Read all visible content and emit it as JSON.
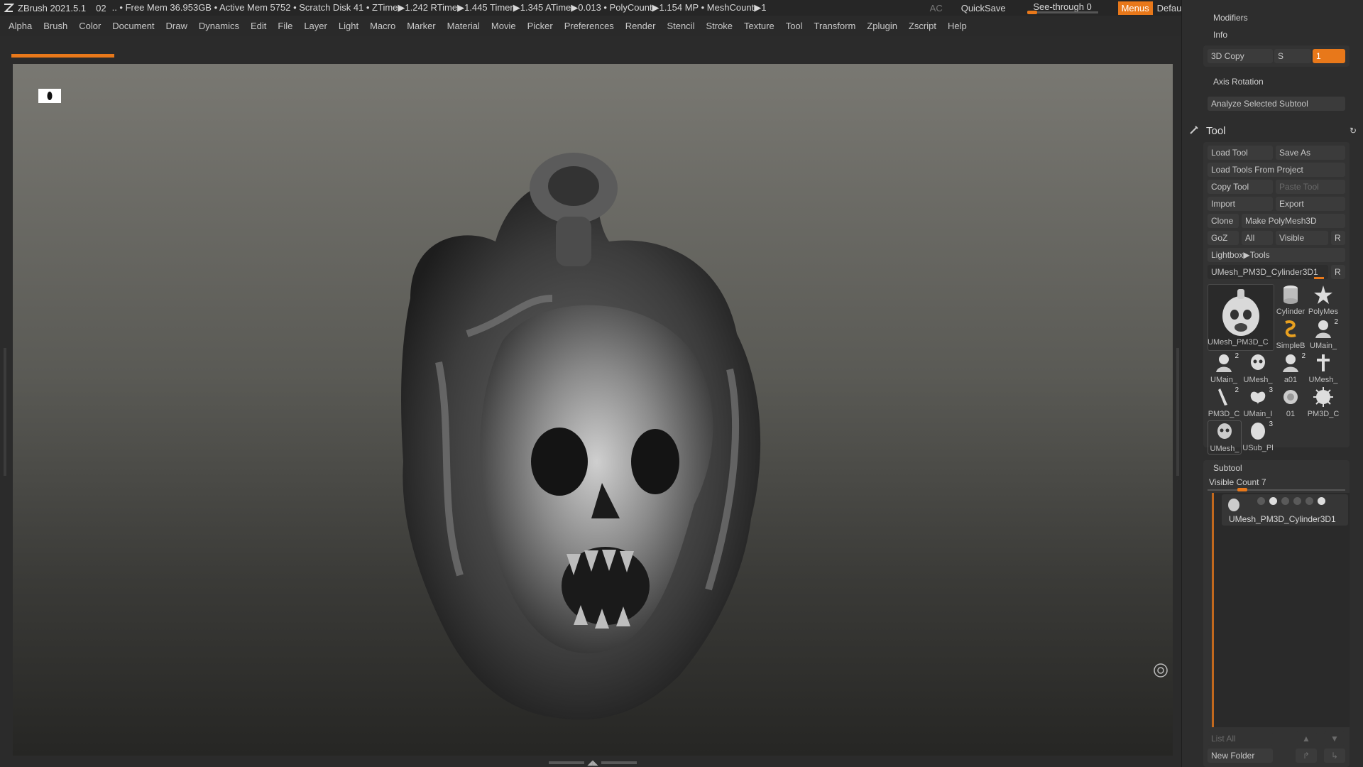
{
  "titlebar": {
    "title": "ZBrush 2021.5.1",
    "doc_index": "02",
    "stats": ".. • Free Mem 36.953GB • Active Mem 5752 • Scratch Disk 41 •  ZTime▶1.242 RTime▶1.445 Timer▶1.345 ATime▶0.013 • PolyCount▶1.154 MP  • MeshCount▶1",
    "ac": "AC",
    "quicksave": "QuickSave",
    "see_through": "See-through  0",
    "menus": "Menus",
    "default_zscript": "DefaultZScript"
  },
  "menubar": [
    "Alpha",
    "Brush",
    "Color",
    "Document",
    "Draw",
    "Dynamics",
    "Edit",
    "File",
    "Layer",
    "Light",
    "Macro",
    "Marker",
    "Material",
    "Movie",
    "Picker",
    "Preferences",
    "Render",
    "Stencil",
    "Stroke",
    "Texture",
    "Tool",
    "Transform",
    "Zplugin",
    "Zscript",
    "Help"
  ],
  "panel": {
    "modifiers": "Modifiers",
    "info": "Info",
    "copy3d": "3D Copy",
    "s_label": "S",
    "s_value": "1",
    "axis_rotation": "Axis Rotation",
    "analyze": "Analyze Selected Subtool",
    "tool_title": "Tool",
    "load_tool": "Load Tool",
    "save_as": "Save As",
    "load_from_project": "Load Tools From Project",
    "copy_tool": "Copy Tool",
    "paste_tool": "Paste Tool",
    "import": "Import",
    "export": "Export",
    "clone": "Clone",
    "make_polymesh": "Make PolyMesh3D",
    "goz": "GoZ",
    "all": "All",
    "visible": "Visible",
    "r1": "R",
    "lightbox_tools": "Lightbox▶Tools",
    "current_tool": "UMesh_PM3D_Cylinder3D1",
    "r2": "R",
    "main_thumb_label": "UMesh_PM3D_C",
    "thumbs": [
      {
        "label": "Cylinder",
        "num": ""
      },
      {
        "label": "PolyMes",
        "num": ""
      },
      {
        "label": "SimpleB",
        "num": ""
      },
      {
        "label": "UMain_",
        "num": "2"
      },
      {
        "label": "UMain_",
        "num": "2"
      },
      {
        "label": "UMesh_",
        "num": ""
      },
      {
        "label": "a01",
        "num": "2"
      },
      {
        "label": "UMesh_",
        "num": ""
      },
      {
        "label": "PM3D_C",
        "num": "2"
      },
      {
        "label": "UMain_I",
        "num": "3"
      },
      {
        "label": "01",
        "num": ""
      },
      {
        "label": "PM3D_C",
        "num": ""
      },
      {
        "label": "UMesh_",
        "num": ""
      },
      {
        "label": "USub_Pl",
        "num": "3"
      }
    ],
    "subtool": "Subtool",
    "visible_count": "Visible Count 7",
    "subtool_item": "UMesh_PM3D_Cylinder3D1",
    "list_all": "List All",
    "new_folder": "New Folder"
  },
  "colors": {
    "accent": "#e8781a",
    "panel_bg": "#2d2d2d",
    "button_bg": "#3b3b3b"
  },
  "icons": {
    "logo": "zbrush-logo-icon",
    "persp": "perspective-icon",
    "floor": "floor-grid-icon",
    "tool": "brush-tool-icon"
  }
}
